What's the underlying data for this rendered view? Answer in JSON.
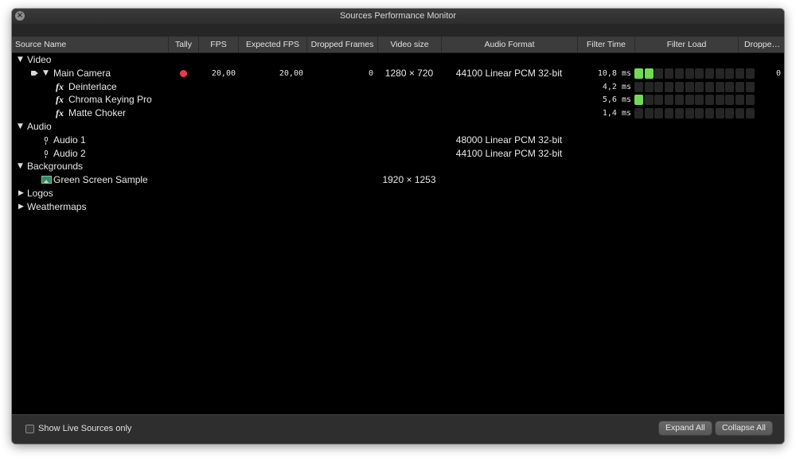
{
  "window": {
    "title": "Sources Performance Monitor"
  },
  "columns": {
    "source_name": "Source Name",
    "tally": "Tally",
    "fps": "FPS",
    "expected_fps": "Expected FPS",
    "dropped_frames": "Dropped Frames",
    "video_size": "Video size",
    "audio_format": "Audio Format",
    "filter_time": "Filter Time",
    "filter_load": "Filter Load",
    "dropped_trunc": "Droppe…"
  },
  "groups": {
    "video": "Video",
    "audio": "Audio",
    "backgrounds": "Backgrounds",
    "logos": "Logos",
    "weathermaps": "Weathermaps"
  },
  "main_camera": {
    "name": "Main Camera",
    "tally": "live",
    "fps": "20,00",
    "expected_fps": "20,00",
    "dropped_frames": "0",
    "video_size": "1280 × 720",
    "audio_format": "44100 Linear PCM 32-bit",
    "filter_time": "10,8 ms",
    "filter_load": 0.17,
    "dropped_trunc": "0"
  },
  "filters": [
    {
      "icon": "fx",
      "name": "Deinterlace",
      "filter_time": "4,2 ms",
      "filter_load": 0.0
    },
    {
      "icon": "fx",
      "name": "Chroma Keying Pro",
      "filter_time": "5,6 ms",
      "filter_load": 0.08
    },
    {
      "icon": "fx",
      "name": "Matte Choker",
      "filter_time": "1,4 ms",
      "filter_load": 0.0
    }
  ],
  "audio_sources": [
    {
      "name": "Audio 1",
      "audio_format": "48000 Linear PCM 32-bit"
    },
    {
      "name": "Audio 2",
      "audio_format": "44100 Linear PCM 32-bit"
    }
  ],
  "background_sources": [
    {
      "name": "Green Screen Sample",
      "video_size": "1920 × 1253"
    }
  ],
  "footer": {
    "show_live_label": "Show Live Sources only",
    "show_live_checked": false,
    "expand_all": "Expand All",
    "collapse_all": "Collapse All"
  },
  "colors": {
    "tally_live": "#f2364d",
    "meter_on": "#6fdd4e",
    "meter_off": "#262626"
  }
}
